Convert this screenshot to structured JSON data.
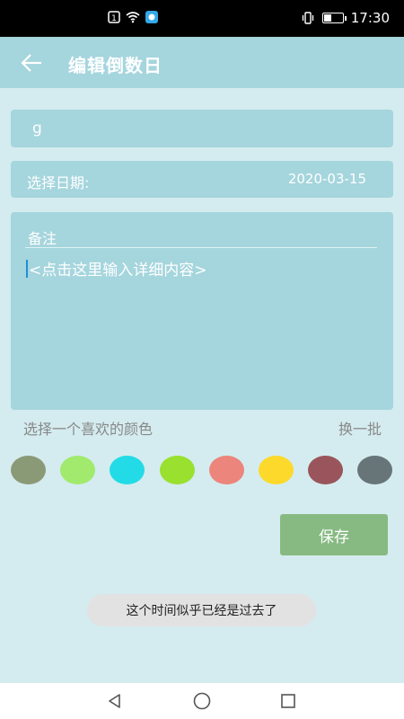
{
  "status_bar": {
    "time": "17:30",
    "battery_level": 0.45,
    "icons": [
      "notification-icon",
      "wifi-icon",
      "app-badge-icon",
      "vibrate-icon",
      "battery-icon"
    ]
  },
  "header": {
    "title": "编辑倒数日",
    "back_icon": "arrow-left-icon"
  },
  "form": {
    "name_value": "g",
    "date_label": "选择日期:",
    "date_value": "2020-03-15",
    "note_title": "备注",
    "note_placeholder": "<点击这里输入详细内容>"
  },
  "colors": {
    "label": "选择一个喜欢的颜色",
    "refresh_label": "换一批",
    "swatches": [
      "#8b9a76",
      "#a1ea6e",
      "#22dbe6",
      "#9ae02f",
      "#ec857b",
      "#fcd92b",
      "#9a555c",
      "#677579"
    ]
  },
  "actions": {
    "save_label": "保存"
  },
  "toast": {
    "message": "这个时间似乎已经是过去了"
  },
  "nav_bar": {
    "icons": [
      "back-triangle-icon",
      "home-circle-icon",
      "recents-square-icon"
    ]
  },
  "theme": {
    "background": "#d4ecef",
    "primary": "#a5d5dd",
    "save_green": "#87ba82"
  }
}
